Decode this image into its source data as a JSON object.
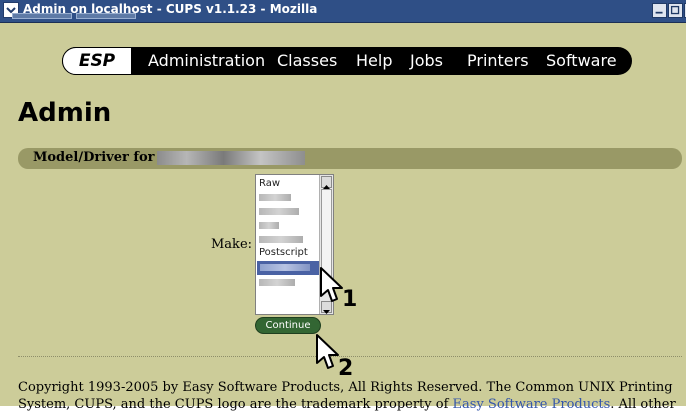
{
  "window": {
    "title": "Admin on localhost - CUPS v1.1.23 - Mozilla",
    "icons": {
      "system": "chevron-down-icon",
      "minimize": "minimize-icon",
      "maximize": "maximize-icon",
      "close": "close-icon"
    }
  },
  "nav": {
    "brand": "ESP",
    "items": [
      "Administration",
      "Classes",
      "Help",
      "Jobs",
      "Printers",
      "Software"
    ]
  },
  "page": {
    "title": "Admin",
    "section_label": "Model/Driver for"
  },
  "form": {
    "make_label": "Make:",
    "listbox": {
      "visible_items": [
        "Raw",
        "Postscript"
      ],
      "selected_index": 7
    },
    "continue_label": "Continue"
  },
  "callouts": {
    "step1": "1",
    "step2": "2"
  },
  "footer": {
    "line1": "Copyright 1993-2005 by Easy Software Products, All Rights Reserved. The Common UNIX Printing",
    "line2_start": "System, CUPS, and the CUPS logo are the trademark property of ",
    "line2_link": "Easy Software Products",
    "line2_end": ". All other"
  },
  "colors": {
    "page_background": "#cccc99",
    "section_bar": "#999966",
    "titlebar": "#2f4f86",
    "button": "#336633",
    "selection": "#4a62a4"
  }
}
